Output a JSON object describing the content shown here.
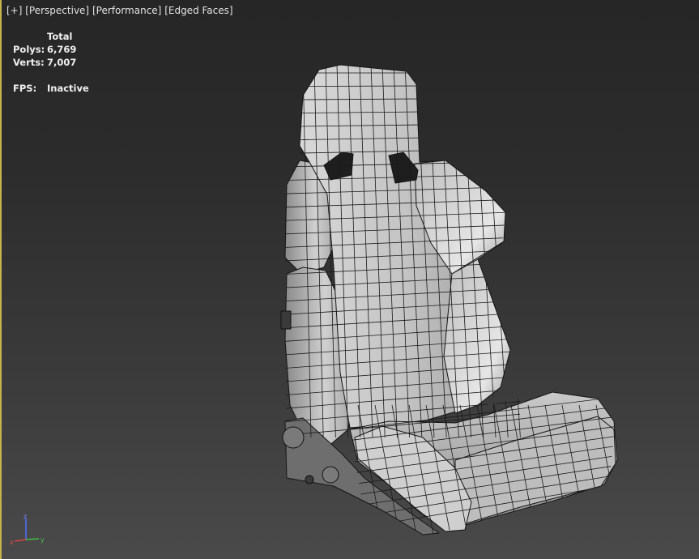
{
  "viewport": {
    "label_items": [
      "[+]",
      "[Perspective]",
      "[Performance]",
      "[Edged Faces]"
    ]
  },
  "stats": {
    "header": "Total",
    "polys_label": "Polys:",
    "polys_value": "6,769",
    "verts_label": "Verts:",
    "verts_value": "7,007",
    "fps_label": "FPS:",
    "fps_value": "Inactive"
  },
  "axis": {
    "x": "x",
    "y": "y",
    "z": "z"
  },
  "colors": {
    "active_border": "#c8b24a",
    "axis_x": "#e04040",
    "axis_y": "#40c040",
    "axis_z": "#5070ff",
    "mesh_surface": "#b8b8b8",
    "wire": "#1a1a1a"
  }
}
